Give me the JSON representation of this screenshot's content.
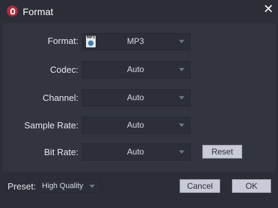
{
  "window": {
    "title": "Format"
  },
  "rows": [
    {
      "label": "Format:",
      "value": "MP3",
      "icon_tag": "MP3"
    },
    {
      "label": "Codec:",
      "value": "Auto"
    },
    {
      "label": "Channel:",
      "value": "Auto"
    },
    {
      "label": "Sample Rate:",
      "value": "Auto"
    },
    {
      "label": "Bit Rate:",
      "value": "Auto"
    }
  ],
  "reset_label": "Reset",
  "footer": {
    "preset_label": "Preset:",
    "preset_value": "High Quality",
    "cancel_label": "Cancel",
    "ok_label": "OK"
  }
}
